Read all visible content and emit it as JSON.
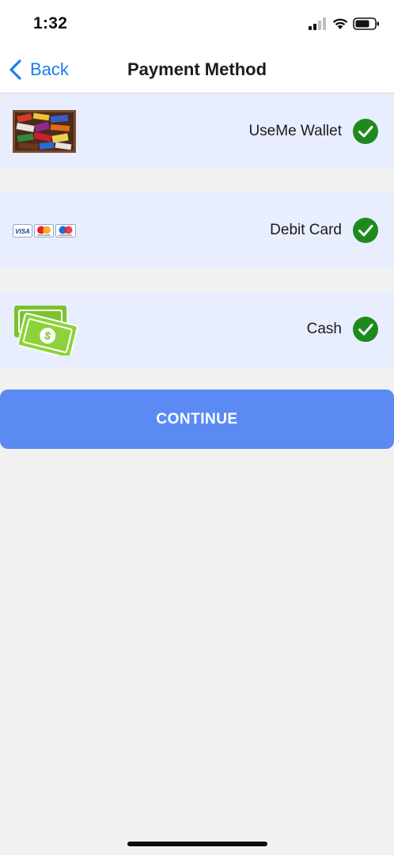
{
  "status_bar": {
    "time": "1:32",
    "signal_icon": "cellular-signal-icon",
    "wifi_icon": "wifi-icon",
    "battery_icon": "battery-icon"
  },
  "nav": {
    "back_label": "Back",
    "title": "Payment Method"
  },
  "payment_methods": [
    {
      "label": "UseMe Wallet",
      "icon": "wallet-candy-image",
      "selected": true
    },
    {
      "label": "Debit Card",
      "icon": "card-brands-icon",
      "selected": true
    },
    {
      "label": "Cash",
      "icon": "cash-icon",
      "selected": true
    }
  ],
  "continue_label": "CONTINUE",
  "colors": {
    "accent": "#1a7ef0",
    "button": "#5b8af3",
    "row_background": "#e8eefe",
    "check": "#1e8a1e",
    "page_background": "#f1f1f1"
  }
}
